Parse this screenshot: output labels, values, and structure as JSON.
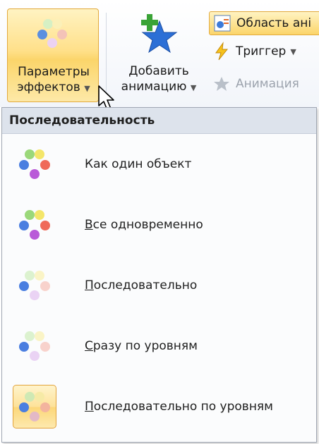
{
  "ribbon": {
    "effects_button": {
      "line1": "Параметры",
      "line2": "эффектов",
      "icon": "effect-options-icon"
    },
    "add_animation_button": {
      "line1": "Добавить",
      "line2": "анимацию",
      "icon": "add-animation-star-icon"
    },
    "animation_pane_button": {
      "label": "Область ані",
      "icon": "animation-pane-icon"
    },
    "trigger_button": {
      "label": "Триггер",
      "icon": "lightning-icon"
    },
    "animation_painter_button": {
      "label": "Анимация",
      "icon": "animation-painter-icon"
    }
  },
  "menu": {
    "header": "Последовательность",
    "items": [
      {
        "key_char": "",
        "rest": "Как один объект",
        "icon": "as-one-object-icon",
        "selected": false
      },
      {
        "key_char": "В",
        "rest": "се одновременно",
        "icon": "all-at-once-icon",
        "selected": false
      },
      {
        "key_char": "П",
        "rest": "оследовательно",
        "icon": "by-paragraph-icon",
        "selected": false
      },
      {
        "key_char": "С",
        "rest": "разу по уровням",
        "icon": "by-level-at-once-icon",
        "selected": false
      },
      {
        "key_char": "П",
        "rest": "оследовательно по уровням",
        "icon": "by-level-sequential-icon",
        "selected": true
      }
    ]
  },
  "colors": {
    "highlight_border": "#e2a93c",
    "highlight_fill": "#fde08a",
    "header_bg": "#dde3ec"
  }
}
